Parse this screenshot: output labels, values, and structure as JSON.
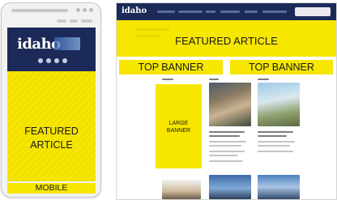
{
  "mobile": {
    "logo_text": "idaho",
    "featured_label_line1": "FEATURED",
    "featured_label_line2": "ARTICLE",
    "device_label": "MOBILE"
  },
  "desktop": {
    "logo_text": "idaho",
    "featured_label": "FEATURED ARTICLE",
    "top_banner_left": "TOP BANNER",
    "top_banner_right": "TOP BANNER",
    "large_banner_line1": "LARGE",
    "large_banner_line2": "BANNER"
  },
  "colors": {
    "brand_navy": "#1c2a59",
    "ad_yellow": "#f6e600"
  }
}
